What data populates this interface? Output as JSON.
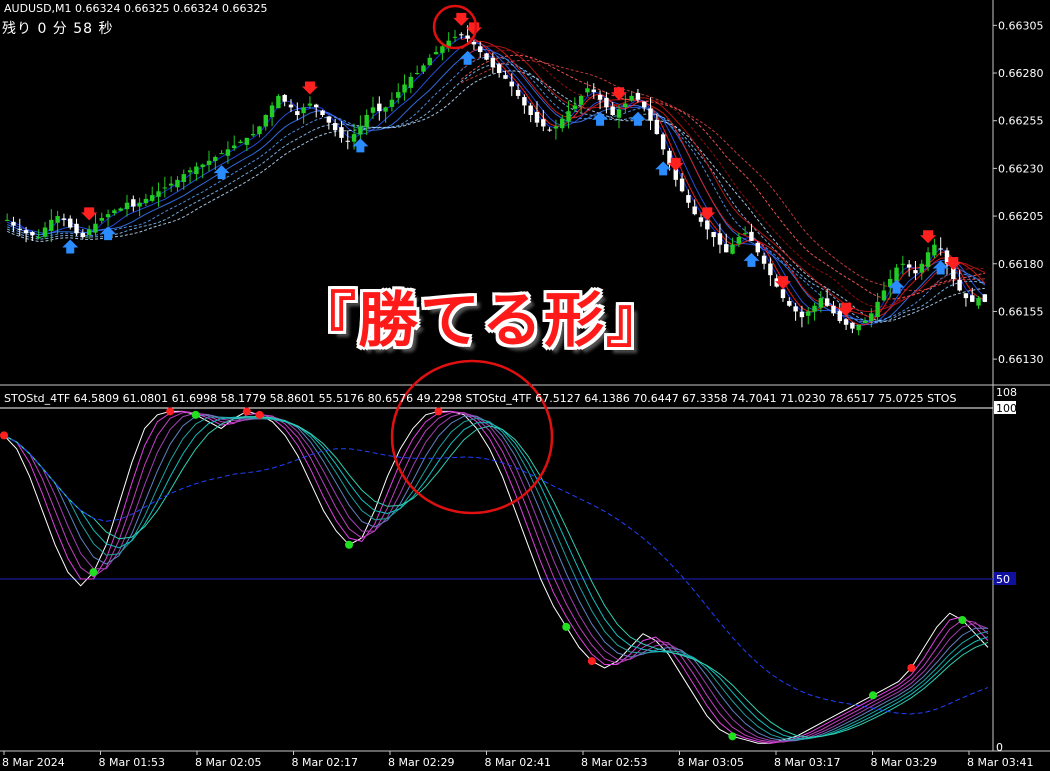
{
  "header": {
    "symbol_line": "AUDUSD,M1  0.66324 0.66325 0.66324 0.66325",
    "remaining": "残り 0 分 58 秒"
  },
  "overlay_text": "『勝てる形』",
  "indicator": {
    "label": "STOStd_4TF 64.5809 61.0801 61.6998 58.1779 58.8601 55.5176 80.6576 49.2298   STOStd_4TF 67.5127 64.1386 70.6447 67.3358 74.7041 71.0230 78.6517 75.0725   STOS",
    "scale_top": "108",
    "level_100": "100",
    "level_50": "50",
    "level_0": "0"
  },
  "colors": {
    "bull": "#22cc22",
    "bear": "#ffffff",
    "up_arrow": "#2a8cff",
    "down_arrow": "#ff2020",
    "highlight_circle": "#e01010"
  },
  "chart_data": {
    "type": "candlestick",
    "price_axis": {
      "ticks": [
        "0.66305",
        "0.66280",
        "0.66255",
        "0.66230",
        "0.66205",
        "0.66180",
        "0.66155",
        "0.66130"
      ],
      "range": [
        0.66118,
        0.66312
      ]
    },
    "time_axis": {
      "labels": [
        "8 Mar 2024",
        "8 Mar 01:53",
        "8 Mar 02:05",
        "8 Mar 02:17",
        "8 Mar 02:29",
        "8 Mar 02:41",
        "8 Mar 02:53",
        "8 Mar 03:05",
        "8 Mar 03:17",
        "8 Mar 03:29",
        "8 Mar 03:41"
      ]
    },
    "close_path": [
      0.66203,
      0.662,
      0.66198,
      0.66196,
      0.66195,
      0.66194,
      0.66199,
      0.66203,
      0.66205,
      0.66203,
      0.66199,
      0.66196,
      0.66194,
      0.66198,
      0.66201,
      0.66204,
      0.66206,
      0.66208,
      0.66209,
      0.66212,
      0.6621,
      0.66212,
      0.66214,
      0.66216,
      0.66218,
      0.6622,
      0.66222,
      0.66224,
      0.66227,
      0.66229,
      0.66231,
      0.66232,
      0.66234,
      0.66236,
      0.66238,
      0.6624,
      0.66242,
      0.66244,
      0.66246,
      0.66248,
      0.66252,
      0.66258,
      0.66263,
      0.66268,
      0.66265,
      0.66262,
      0.66258,
      0.66262,
      0.66264,
      0.66262,
      0.66258,
      0.66254,
      0.6625,
      0.66246,
      0.66244,
      0.66248,
      0.66252,
      0.66258,
      0.66262,
      0.6626,
      0.66262,
      0.66266,
      0.6627,
      0.66274,
      0.66278,
      0.6628,
      0.66284,
      0.66288,
      0.66291,
      0.66294,
      0.66297,
      0.66299,
      0.663,
      0.66298,
      0.66295,
      0.66291,
      0.66287,
      0.66283,
      0.6628,
      0.66277,
      0.66273,
      0.66268,
      0.66263,
      0.66258,
      0.66254,
      0.66252,
      0.6625,
      0.66252,
      0.66256,
      0.6626,
      0.66263,
      0.66268,
      0.66272,
      0.6627,
      0.66266,
      0.66262,
      0.66258,
      0.66261,
      0.66264,
      0.66268,
      0.66266,
      0.66262,
      0.66255,
      0.66248,
      0.6624,
      0.66232,
      0.66224,
      0.66218,
      0.66212,
      0.66206,
      0.66202,
      0.66198,
      0.66194,
      0.6619,
      0.66186,
      0.6619,
      0.66194,
      0.66196,
      0.66192,
      0.66186,
      0.6618,
      0.66174,
      0.66168,
      0.66162,
      0.66158,
      0.66155,
      0.66152,
      0.66155,
      0.66158,
      0.66162,
      0.66158,
      0.66154,
      0.6615,
      0.66148,
      0.66146,
      0.66148,
      0.6615,
      0.66154,
      0.6616,
      0.66166,
      0.66172,
      0.66178,
      0.6618,
      0.66178,
      0.66175,
      0.6618,
      0.66186,
      0.6619,
      0.66188,
      0.6618,
      0.66172,
      0.66166,
      0.66162,
      0.6616,
      0.66162,
      0.6616
    ],
    "indicator_levels": [
      "100",
      "50",
      "0"
    ],
    "indicator_main_path": [
      92,
      88,
      80,
      70,
      60,
      52,
      48,
      52,
      60,
      72,
      84,
      94,
      98,
      99,
      99,
      98,
      96,
      94,
      97,
      99,
      98,
      96,
      92,
      86,
      78,
      70,
      64,
      60,
      62,
      70,
      80,
      88,
      94,
      98,
      99,
      99,
      98,
      94,
      88,
      80,
      70,
      60,
      50,
      42,
      36,
      30,
      26,
      24,
      26,
      30,
      34,
      32,
      28,
      22,
      16,
      10,
      6,
      4,
      3,
      2,
      2,
      3,
      4,
      6,
      8,
      10,
      12,
      14,
      16,
      18,
      20,
      24,
      30,
      36,
      40,
      38,
      34,
      30
    ]
  }
}
